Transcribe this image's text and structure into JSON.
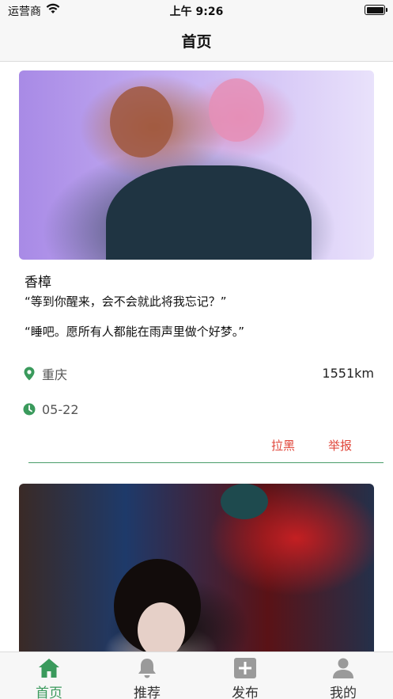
{
  "status_bar": {
    "carrier": "运营商",
    "time": "上午 9:26"
  },
  "nav": {
    "title": "首页"
  },
  "posts": [
    {
      "name": "香樟",
      "quote_1": "“等到你醒来，会不会就此将我忘记？”",
      "quote_2": "“睡吧。愿所有人都能在雨声里做个好梦。”",
      "location": "重庆",
      "distance": "1551km",
      "date": "05-22",
      "block_label": "拉黑",
      "report_label": "举报"
    }
  ],
  "tabs": [
    {
      "label": "首页",
      "icon": "home-icon",
      "active": true
    },
    {
      "label": "推荐",
      "icon": "bell-icon",
      "active": false
    },
    {
      "label": "发布",
      "icon": "plus-square-icon",
      "active": false
    },
    {
      "label": "我的",
      "icon": "person-icon",
      "active": false
    }
  ],
  "colors": {
    "accent_green": "#3a9a5c",
    "action_red": "#e0453a",
    "bar_bg": "#f7f7f7"
  }
}
